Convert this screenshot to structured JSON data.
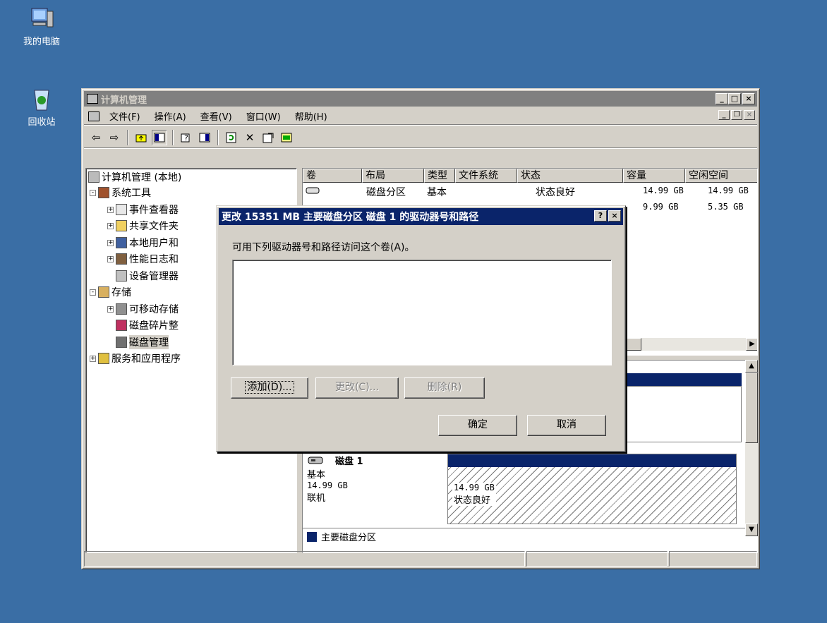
{
  "desktop": {
    "icons": [
      {
        "label": "我的电脑",
        "icon": "my-computer-icon"
      },
      {
        "label": "回收站",
        "icon": "recycle-bin-icon"
      }
    ]
  },
  "window": {
    "title": "计算机管理",
    "menu": [
      "文件(F)",
      "操作(A)",
      "查看(V)",
      "窗口(W)",
      "帮助(H)"
    ],
    "toolbar_icons": [
      "back-icon",
      "forward-icon",
      "up-icon",
      "show-tree-icon",
      "help-icon",
      "properties-pane-icon",
      "refresh-icon",
      "delete-icon",
      "properties-icon",
      "export-icon"
    ],
    "tree": [
      {
        "label": "计算机管理 (本地)",
        "icon": "computer-icon",
        "level": 0
      },
      {
        "label": "系统工具",
        "icon": "tools-icon",
        "level": 1,
        "expander": "-"
      },
      {
        "label": "事件查看器",
        "icon": "event-viewer-icon",
        "level": 2,
        "expander": "+"
      },
      {
        "label": "共享文件夹",
        "icon": "shared-folder-icon",
        "level": 2,
        "expander": "+"
      },
      {
        "label": "本地用户和",
        "icon": "users-icon",
        "level": 2,
        "expander": "+"
      },
      {
        "label": "性能日志和",
        "icon": "performance-icon",
        "level": 2,
        "expander": "+"
      },
      {
        "label": "设备管理器",
        "icon": "device-manager-icon",
        "level": 2
      },
      {
        "label": "存储",
        "icon": "storage-icon",
        "level": 1,
        "expander": "-"
      },
      {
        "label": "可移动存储",
        "icon": "removable-storage-icon",
        "level": 2,
        "expander": "+"
      },
      {
        "label": "磁盘碎片整",
        "icon": "defrag-icon",
        "level": 2
      },
      {
        "label": "磁盘管理",
        "icon": "disk-management-icon",
        "level": 2,
        "selected": true
      },
      {
        "label": "服务和应用程序",
        "icon": "services-icon",
        "level": 1,
        "expander": "+"
      }
    ],
    "list": {
      "columns": [
        "卷",
        "布局",
        "类型",
        "文件系统",
        "状态",
        "容量",
        "空闲空间"
      ],
      "rows": [
        {
          "volume": "",
          "layout": "磁盘分区",
          "type": "基本",
          "fs": "",
          "status": "状态良好",
          "capacity": "14.99 GB",
          "free": "14.99 GB"
        },
        {
          "volume": "",
          "layout": "",
          "type": "",
          "fs": "",
          "status": "",
          "capacity": "9.99 GB",
          "free": "5.35 GB"
        }
      ]
    },
    "disk": {
      "name": "磁盘 1",
      "type": "基本",
      "size": "14.99 GB",
      "state": "联机",
      "partition_size": "14.99 GB",
      "partition_status": "状态良好"
    },
    "legend": "主要磁盘分区"
  },
  "dialog": {
    "title": "更改 15351 MB 主要磁盘分区 磁盘 1 的驱动器号和路径",
    "prompt": "可用下列驱动器号和路径访问这个卷(A)。",
    "buttons": {
      "add": "添加(D)...",
      "change": "更改(C)...",
      "remove": "删除(R)",
      "ok": "确定",
      "cancel": "取消"
    },
    "help": "?",
    "close": "×"
  }
}
